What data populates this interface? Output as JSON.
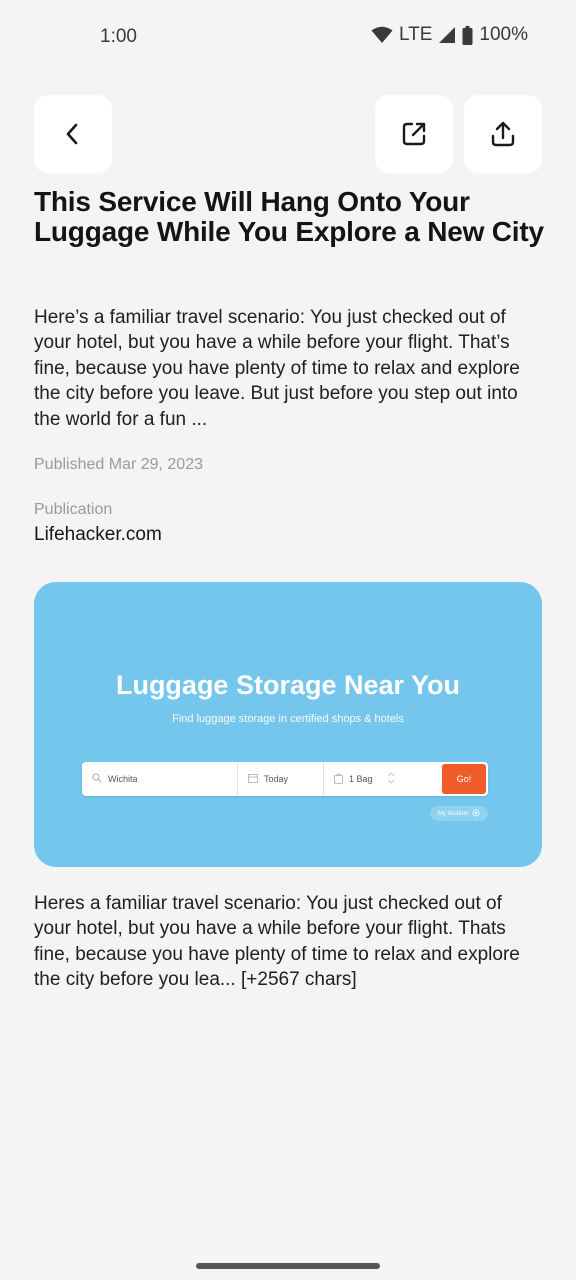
{
  "status_bar": {
    "time": "1:00",
    "network": "LTE",
    "battery": "100%"
  },
  "toolbar": {
    "back_icon": "chevron-left-icon",
    "open_external_icon": "open-external-icon",
    "share_icon": "share-icon"
  },
  "article": {
    "title": "This Service Will Hang Onto Your Luggage While You Explore a New City",
    "summary": "Here’s a familiar travel scenario: You just checked out of your hotel, but you have a while before your flight. That’s fine, because you have plenty of time to relax and explore the city before you leave. But just before you step out into the world for a fun ...",
    "published": "Published Mar 29, 2023",
    "publication_label": "Publication",
    "publication": "Lifehacker.com",
    "body": "Heres a familiar travel scenario: You just checked out of your hotel, but you have a while before your flight. Thats fine, because you have plenty of time to relax and explore the city before you lea... [+2567 chars]"
  },
  "hero_image": {
    "background_color": "#74c6ec",
    "title": "Luggage Storage Near You",
    "subtitle": "Find luggage storage in certified shops & hotels",
    "search": {
      "location": "Wichita",
      "date": "Today",
      "bags": "1 Bag",
      "go": "Go!",
      "go_color": "#ef5b2b",
      "my_location": "My location"
    }
  }
}
